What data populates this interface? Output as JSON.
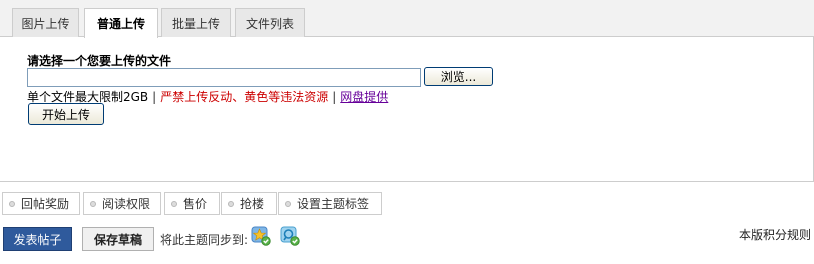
{
  "tabs": [
    {
      "label": "图片上传",
      "active": false
    },
    {
      "label": "普通上传",
      "active": true
    },
    {
      "label": "批量上传",
      "active": false
    },
    {
      "label": "文件列表",
      "active": false
    }
  ],
  "upload": {
    "title": "请选择一个您要上传的文件",
    "file_value": "",
    "browse_label": "浏览...",
    "limit_text": "单个文件最大限制2GB",
    "separator": "|",
    "warning_text": "严禁上传反动、黄色等违法资源",
    "provider_link": "网盘提供",
    "start_label": "开始上传"
  },
  "options": [
    {
      "label": "回帖奖励"
    },
    {
      "label": "阅读权限"
    },
    {
      "label": "售价"
    },
    {
      "label": "抢楼"
    },
    {
      "label": "设置主题标签"
    }
  ],
  "actions": {
    "post_label": "发表帖子",
    "draft_label": "保存草稿",
    "sync_label": "将此主题同步到:",
    "sync_icons": [
      "qzone-star-icon",
      "tencent-weibo-icon"
    ],
    "rules_label": "本版积分规则"
  },
  "colors": {
    "warning": "#cc0000",
    "link": "#660099",
    "post_button": "#2f5a9c"
  }
}
